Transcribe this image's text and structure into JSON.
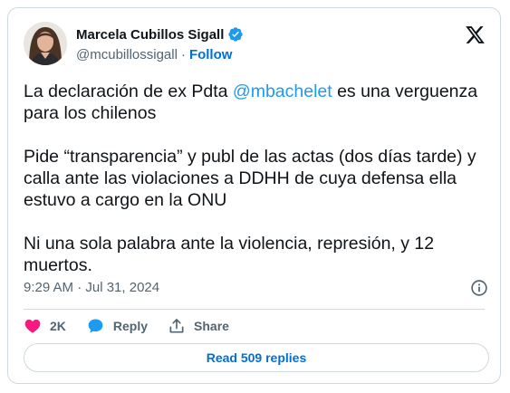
{
  "author": {
    "name": "Marcela Cubillos Sigall",
    "handle": "@mcubillossigall",
    "separator": "·",
    "follow_label": "Follow"
  },
  "tweet": {
    "line1_prefix": "La declaración de ex Pdta ",
    "mention": "@mbachelet",
    "line1_suffix": " es una verguenza para los chilenos",
    "paragraph2": "Pide “transparencia” y publ de las actas (dos días tarde) y calla ante las violaciones a DDHH de cuya defensa ella estuvo a cargo en la ONU",
    "paragraph3": "Ni una sola palabra ante la violencia, represión, y 12 muertos."
  },
  "meta": {
    "timestamp": "9:29 AM · Jul 31, 2024"
  },
  "actions": {
    "likes_count": "2K",
    "reply_label": "Reply",
    "share_label": "Share"
  },
  "replies_button_label": "Read 509 replies",
  "icons": {
    "verified": "verified-badge-icon",
    "brand": "x-logo-icon",
    "info": "info-icon",
    "like": "heart-icon",
    "reply": "speech-bubble-icon",
    "share": "share-upload-icon"
  },
  "colors": {
    "accent": "#1d9bf0",
    "link": "#006fd6",
    "like": "#f91880",
    "text": "#0f1419",
    "muted": "#536471",
    "border": "#cfd9de"
  }
}
